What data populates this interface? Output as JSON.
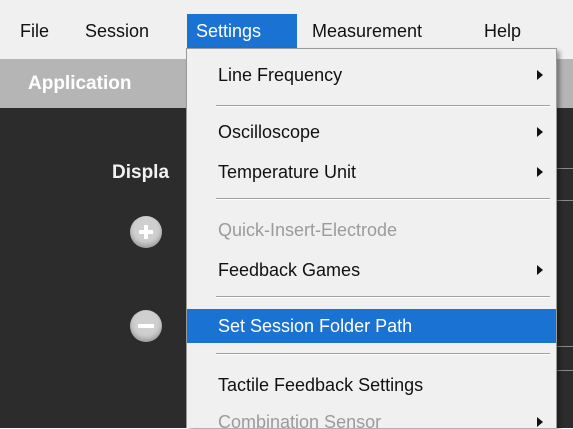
{
  "menubar": {
    "items": [
      {
        "label": "File"
      },
      {
        "label": "Session"
      },
      {
        "label": "Settings"
      },
      {
        "label": "Measurement"
      },
      {
        "label": "Help"
      }
    ]
  },
  "app": {
    "title": "Application",
    "display_label": "Displa"
  },
  "settings_menu": {
    "items": [
      {
        "label": "Line Frequency",
        "submenu": true,
        "enabled": true
      },
      {
        "label": "Oscilloscope",
        "submenu": true,
        "enabled": true
      },
      {
        "label": "Temperature Unit",
        "submenu": true,
        "enabled": true
      },
      {
        "label": "Quick-Insert-Electrode",
        "submenu": false,
        "enabled": false
      },
      {
        "label": "Feedback Games",
        "submenu": true,
        "enabled": true
      },
      {
        "label": "Set Session Folder Path",
        "submenu": false,
        "enabled": true,
        "highlighted": true
      },
      {
        "label": "Tactile Feedback Settings",
        "submenu": false,
        "enabled": true
      },
      {
        "label": "Combination Sensor",
        "submenu": true,
        "enabled": false
      }
    ]
  },
  "colors": {
    "accent": "#1a72d3",
    "menu_bg": "#f0f0f0",
    "app_header": "#b5b5b5",
    "app_body": "#2c2c2c",
    "disabled_text": "#9b9b9b"
  }
}
